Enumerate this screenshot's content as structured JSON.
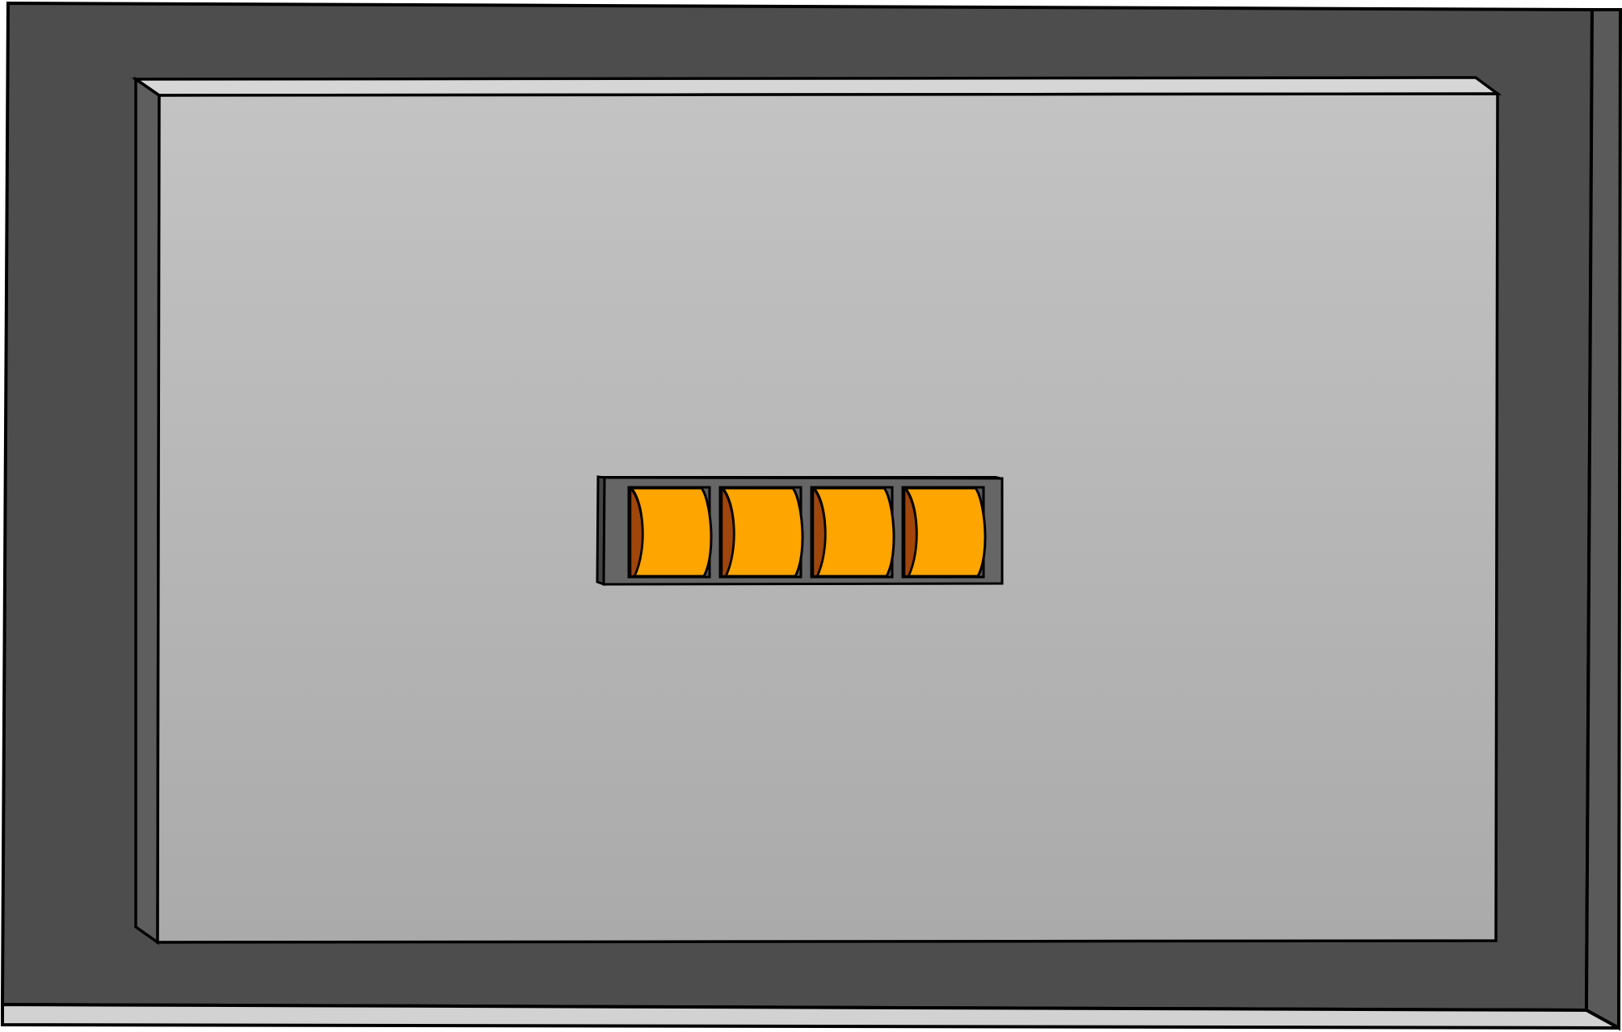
{
  "scene": {
    "description_free": true,
    "colors": {
      "outer_frame": "#4d4d4d",
      "outer_side": "#5a5a5a",
      "outer_bottom": "#d2d2d2",
      "panel_top": "#c3c3c3",
      "panel_bottom": "#aaaaaa",
      "panel_bevel_top": "#d6d6d6",
      "panel_bevel_left": "#5e5e5e",
      "lock_housing": "#666666",
      "dial_face": "#ffa500",
      "dial_shade": "#a0460a",
      "outline": "#000000"
    }
  },
  "combination_lock": {
    "dial_count": 4,
    "digits": [
      "",
      "",
      "",
      ""
    ]
  }
}
